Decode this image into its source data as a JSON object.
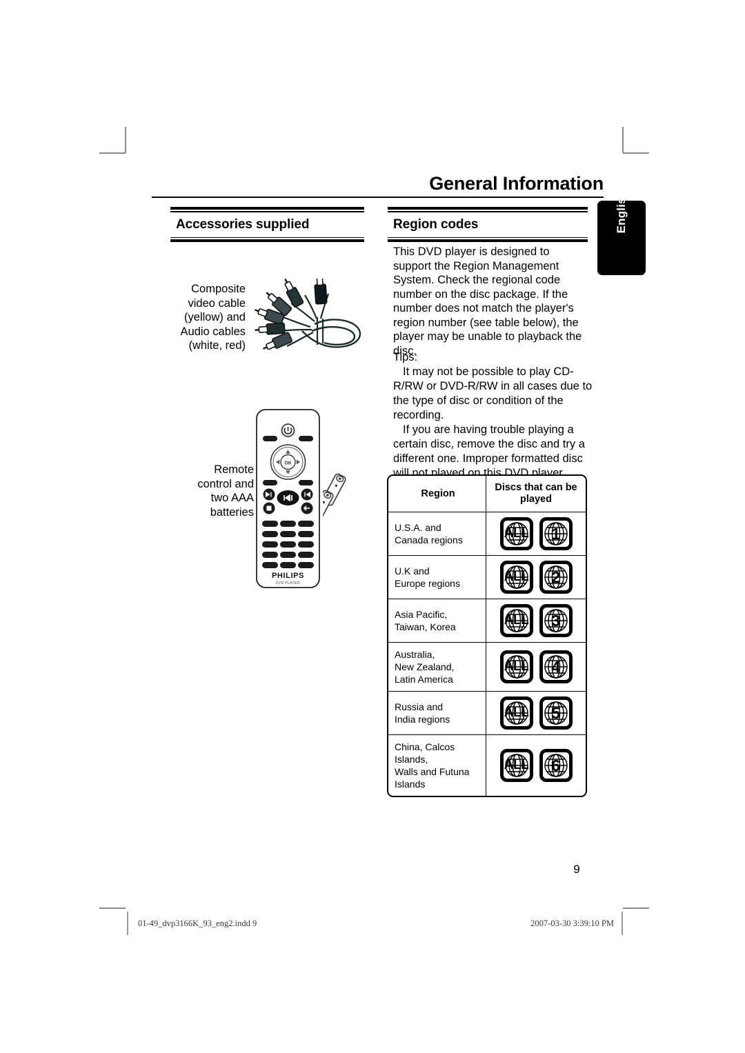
{
  "page": {
    "title": "General Information",
    "language_tab": "English",
    "page_number": "9"
  },
  "sections": {
    "accessories": {
      "heading": "Accessories supplied",
      "items": [
        {
          "caption": "Composite\nvideo cable\n(yellow) and\nAudio cables\n(white, red)",
          "icon": "composite-av-cable-illustration"
        },
        {
          "caption": "Remote\ncontrol and\ntwo AAA\nbatteries",
          "icon": "remote-control-illustration"
        }
      ],
      "remote": {
        "brand": "PHILIPS",
        "sublabel": "DVD PLAYER",
        "ok_label": "OK"
      }
    },
    "region": {
      "heading": "Region codes",
      "intro": "This DVD player is designed to support the Region Management System. Check the regional code number on the disc package. If the number does not match the player's region number (see table below), the player may be unable to playback the disc.",
      "tips_label": "Tips:",
      "tips": [
        "It may not be possible to play CD-R/RW or DVD-R/RW in all cases due to the type of disc or condition of the recording.",
        "If you are having trouble playing a certain disc, remove the disc and try a different one. Improper formatted disc will not played on this DVD player."
      ],
      "table": {
        "headers": [
          "Region",
          "Discs that can\nbe played"
        ],
        "rows": [
          {
            "region": "U.S.A. and\nCanada regions",
            "discs": [
              "ALL",
              "1"
            ]
          },
          {
            "region": "U.K and\nEurope regions",
            "discs": [
              "ALL",
              "2"
            ]
          },
          {
            "region": "Asia Pacific,\nTaiwan, Korea",
            "discs": [
              "ALL",
              "3"
            ]
          },
          {
            "region": "Australia,\nNew Zealand,\nLatin America",
            "discs": [
              "ALL",
              "4"
            ]
          },
          {
            "region": "Russia and\nIndia regions",
            "discs": [
              "ALL",
              "5"
            ]
          },
          {
            "region": "China, Calcos Islands,\nWalls and Futuna\nIslands",
            "discs": [
              "ALL",
              "6"
            ]
          }
        ]
      }
    }
  },
  "footer": {
    "file": "01-49_dvp3166K_93_eng2.indd   9",
    "timestamp": "2007-03-30   3:39:10 PM"
  }
}
